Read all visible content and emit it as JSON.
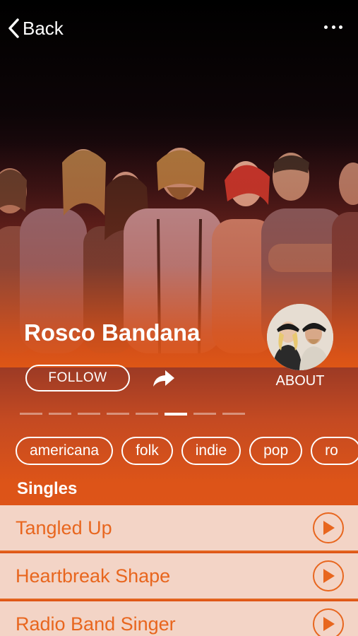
{
  "nav": {
    "back_label": "Back",
    "back_icon": "chevron-left-icon",
    "more_icon": "more-horizontal-icon"
  },
  "artist": {
    "name": "Rosco Bandana",
    "follow_label": "FOLLOW",
    "share_icon": "share-arrow-icon",
    "about_label": "ABOUT"
  },
  "pager": {
    "count": 8,
    "active_index": 5
  },
  "tags": [
    "americana",
    "folk",
    "indie",
    "pop",
    "ro"
  ],
  "singles": {
    "title": "Singles",
    "items": [
      {
        "title": "Tangled Up"
      },
      {
        "title": "Heartbreak Shape"
      },
      {
        "title": "Radio Band Singer"
      }
    ]
  },
  "colors": {
    "accent": "#e8661e",
    "row_bg": "#f3d4c6",
    "gradient_bottom": "#e05716"
  }
}
